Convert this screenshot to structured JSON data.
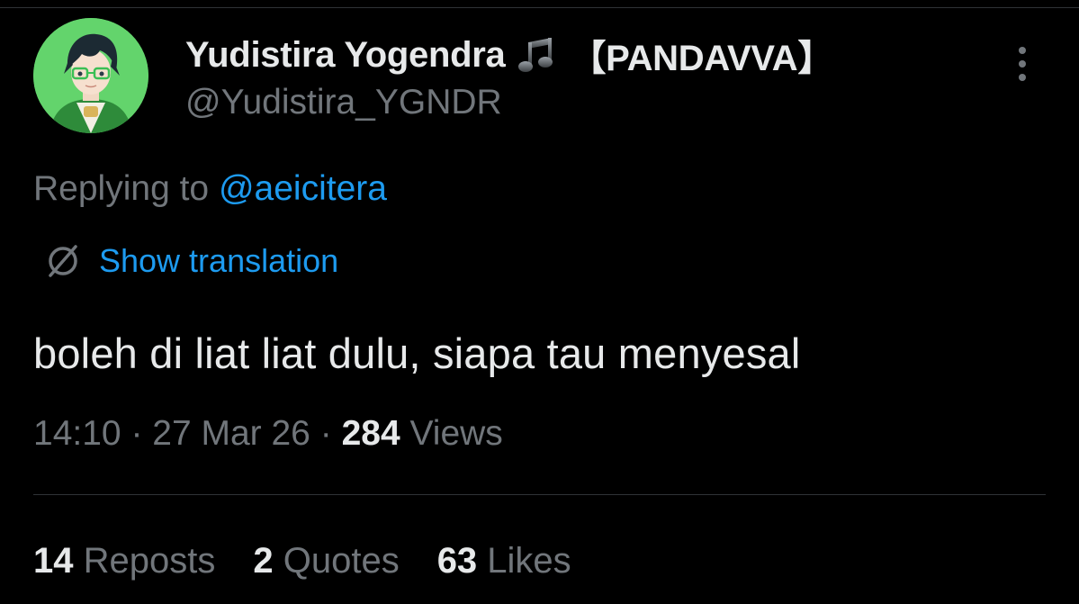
{
  "colors": {
    "background": "#000000",
    "primary_text": "#e7e9ea",
    "secondary_text": "#71767b",
    "accent": "#1d9bf0",
    "divider": "#2f3336"
  },
  "author": {
    "name": "Yudistira Yogendra",
    "name_suffix": "【PANDAVVA】",
    "name_emoji": "musical-note-icon",
    "handle": "@Yudistira_YGNDR",
    "avatar": "avatar-anime-character-green"
  },
  "reply": {
    "prefix": "Replying to ",
    "mention": "@aeicitera"
  },
  "translation": {
    "icon": "translate-globe-icon",
    "label": "Show translation"
  },
  "tweet": {
    "text": "boleh di liat liat dulu, siapa tau menyesal"
  },
  "meta": {
    "time": "14:10",
    "separator1": " · ",
    "date": "27 Mar 26",
    "separator2": " · ",
    "views_count": "284",
    "views_label": " Views"
  },
  "stats": [
    {
      "count": "14",
      "label": " Reposts"
    },
    {
      "count": "2",
      "label": " Quotes"
    },
    {
      "count": "63",
      "label": " Likes"
    }
  ],
  "more_menu": {
    "icon": "more-vertical-icon"
  }
}
